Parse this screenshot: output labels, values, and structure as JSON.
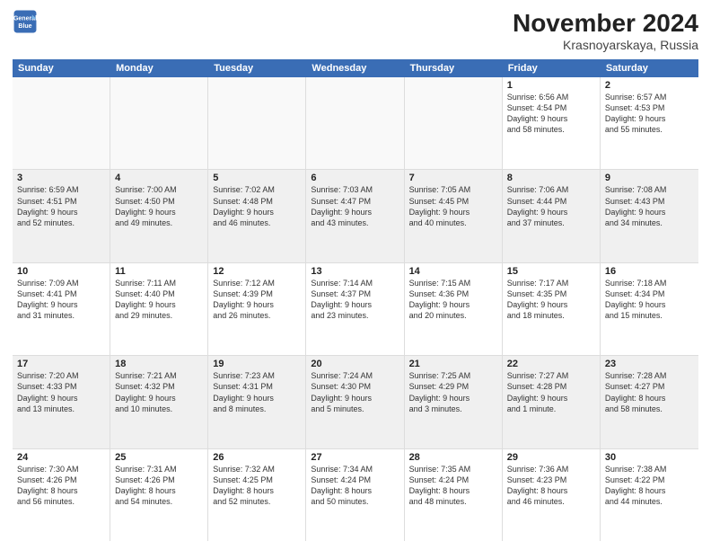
{
  "logo": {
    "line1": "General",
    "line2": "Blue"
  },
  "title": "November 2024",
  "subtitle": "Krasnoyarskaya, Russia",
  "header_days": [
    "Sunday",
    "Monday",
    "Tuesday",
    "Wednesday",
    "Thursday",
    "Friday",
    "Saturday"
  ],
  "rows": [
    [
      {
        "day": "",
        "empty": true
      },
      {
        "day": "",
        "empty": true
      },
      {
        "day": "",
        "empty": true
      },
      {
        "day": "",
        "empty": true
      },
      {
        "day": "",
        "empty": true
      },
      {
        "day": "1",
        "lines": [
          "Sunrise: 6:56 AM",
          "Sunset: 4:54 PM",
          "Daylight: 9 hours",
          "and 58 minutes."
        ]
      },
      {
        "day": "2",
        "lines": [
          "Sunrise: 6:57 AM",
          "Sunset: 4:53 PM",
          "Daylight: 9 hours",
          "and 55 minutes."
        ]
      }
    ],
    [
      {
        "day": "3",
        "lines": [
          "Sunrise: 6:59 AM",
          "Sunset: 4:51 PM",
          "Daylight: 9 hours",
          "and 52 minutes."
        ]
      },
      {
        "day": "4",
        "lines": [
          "Sunrise: 7:00 AM",
          "Sunset: 4:50 PM",
          "Daylight: 9 hours",
          "and 49 minutes."
        ]
      },
      {
        "day": "5",
        "lines": [
          "Sunrise: 7:02 AM",
          "Sunset: 4:48 PM",
          "Daylight: 9 hours",
          "and 46 minutes."
        ]
      },
      {
        "day": "6",
        "lines": [
          "Sunrise: 7:03 AM",
          "Sunset: 4:47 PM",
          "Daylight: 9 hours",
          "and 43 minutes."
        ]
      },
      {
        "day": "7",
        "lines": [
          "Sunrise: 7:05 AM",
          "Sunset: 4:45 PM",
          "Daylight: 9 hours",
          "and 40 minutes."
        ]
      },
      {
        "day": "8",
        "lines": [
          "Sunrise: 7:06 AM",
          "Sunset: 4:44 PM",
          "Daylight: 9 hours",
          "and 37 minutes."
        ]
      },
      {
        "day": "9",
        "lines": [
          "Sunrise: 7:08 AM",
          "Sunset: 4:43 PM",
          "Daylight: 9 hours",
          "and 34 minutes."
        ]
      }
    ],
    [
      {
        "day": "10",
        "lines": [
          "Sunrise: 7:09 AM",
          "Sunset: 4:41 PM",
          "Daylight: 9 hours",
          "and 31 minutes."
        ]
      },
      {
        "day": "11",
        "lines": [
          "Sunrise: 7:11 AM",
          "Sunset: 4:40 PM",
          "Daylight: 9 hours",
          "and 29 minutes."
        ]
      },
      {
        "day": "12",
        "lines": [
          "Sunrise: 7:12 AM",
          "Sunset: 4:39 PM",
          "Daylight: 9 hours",
          "and 26 minutes."
        ]
      },
      {
        "day": "13",
        "lines": [
          "Sunrise: 7:14 AM",
          "Sunset: 4:37 PM",
          "Daylight: 9 hours",
          "and 23 minutes."
        ]
      },
      {
        "day": "14",
        "lines": [
          "Sunrise: 7:15 AM",
          "Sunset: 4:36 PM",
          "Daylight: 9 hours",
          "and 20 minutes."
        ]
      },
      {
        "day": "15",
        "lines": [
          "Sunrise: 7:17 AM",
          "Sunset: 4:35 PM",
          "Daylight: 9 hours",
          "and 18 minutes."
        ]
      },
      {
        "day": "16",
        "lines": [
          "Sunrise: 7:18 AM",
          "Sunset: 4:34 PM",
          "Daylight: 9 hours",
          "and 15 minutes."
        ]
      }
    ],
    [
      {
        "day": "17",
        "lines": [
          "Sunrise: 7:20 AM",
          "Sunset: 4:33 PM",
          "Daylight: 9 hours",
          "and 13 minutes."
        ]
      },
      {
        "day": "18",
        "lines": [
          "Sunrise: 7:21 AM",
          "Sunset: 4:32 PM",
          "Daylight: 9 hours",
          "and 10 minutes."
        ]
      },
      {
        "day": "19",
        "lines": [
          "Sunrise: 7:23 AM",
          "Sunset: 4:31 PM",
          "Daylight: 9 hours",
          "and 8 minutes."
        ]
      },
      {
        "day": "20",
        "lines": [
          "Sunrise: 7:24 AM",
          "Sunset: 4:30 PM",
          "Daylight: 9 hours",
          "and 5 minutes."
        ]
      },
      {
        "day": "21",
        "lines": [
          "Sunrise: 7:25 AM",
          "Sunset: 4:29 PM",
          "Daylight: 9 hours",
          "and 3 minutes."
        ]
      },
      {
        "day": "22",
        "lines": [
          "Sunrise: 7:27 AM",
          "Sunset: 4:28 PM",
          "Daylight: 9 hours",
          "and 1 minute."
        ]
      },
      {
        "day": "23",
        "lines": [
          "Sunrise: 7:28 AM",
          "Sunset: 4:27 PM",
          "Daylight: 8 hours",
          "and 58 minutes."
        ]
      }
    ],
    [
      {
        "day": "24",
        "lines": [
          "Sunrise: 7:30 AM",
          "Sunset: 4:26 PM",
          "Daylight: 8 hours",
          "and 56 minutes."
        ]
      },
      {
        "day": "25",
        "lines": [
          "Sunrise: 7:31 AM",
          "Sunset: 4:26 PM",
          "Daylight: 8 hours",
          "and 54 minutes."
        ]
      },
      {
        "day": "26",
        "lines": [
          "Sunrise: 7:32 AM",
          "Sunset: 4:25 PM",
          "Daylight: 8 hours",
          "and 52 minutes."
        ]
      },
      {
        "day": "27",
        "lines": [
          "Sunrise: 7:34 AM",
          "Sunset: 4:24 PM",
          "Daylight: 8 hours",
          "and 50 minutes."
        ]
      },
      {
        "day": "28",
        "lines": [
          "Sunrise: 7:35 AM",
          "Sunset: 4:24 PM",
          "Daylight: 8 hours",
          "and 48 minutes."
        ]
      },
      {
        "day": "29",
        "lines": [
          "Sunrise: 7:36 AM",
          "Sunset: 4:23 PM",
          "Daylight: 8 hours",
          "and 46 minutes."
        ]
      },
      {
        "day": "30",
        "lines": [
          "Sunrise: 7:38 AM",
          "Sunset: 4:22 PM",
          "Daylight: 8 hours",
          "and 44 minutes."
        ]
      }
    ]
  ]
}
